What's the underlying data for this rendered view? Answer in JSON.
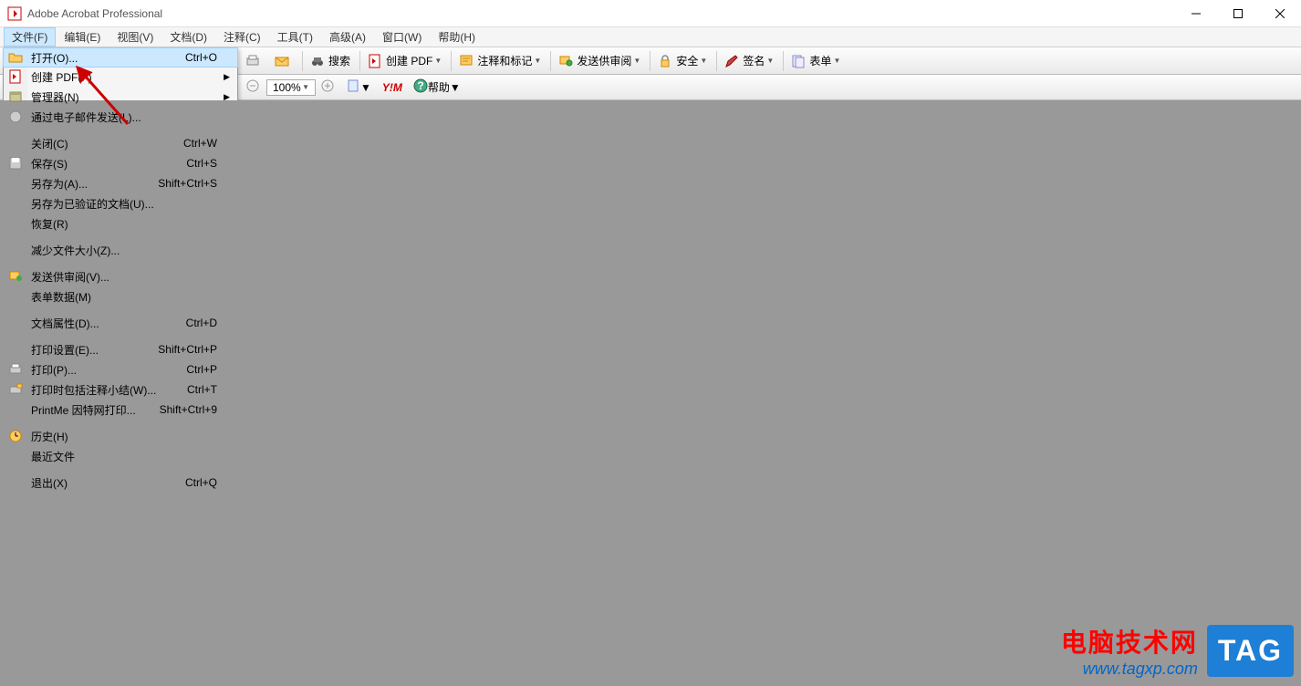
{
  "titlebar": {
    "title": "Adobe Acrobat Professional"
  },
  "menubar": {
    "items": [
      {
        "label": "文件(F)"
      },
      {
        "label": "编辑(E)"
      },
      {
        "label": "视图(V)"
      },
      {
        "label": "文档(D)"
      },
      {
        "label": "注释(C)"
      },
      {
        "label": "工具(T)"
      },
      {
        "label": "高级(A)"
      },
      {
        "label": "窗口(W)"
      },
      {
        "label": "帮助(H)"
      }
    ]
  },
  "toolbar": {
    "search": "搜索",
    "create_pdf": "创建 PDF",
    "comment_mark": "注释和标记",
    "send_review": "发送供审阅",
    "security": "安全",
    "sign": "签名",
    "forms": "表单"
  },
  "toolbar2": {
    "zoom": "100%",
    "help": "帮助"
  },
  "dropdown": {
    "open": {
      "label": "打开(O)...",
      "shortcut": "Ctrl+O"
    },
    "create_pdf": {
      "label": "创建 PDF(F)"
    },
    "organizer": {
      "label": "管理器(N)"
    },
    "email": {
      "label": "通过电子邮件发送(L)..."
    },
    "close": {
      "label": "关闭(C)",
      "shortcut": "Ctrl+W"
    },
    "save": {
      "label": "保存(S)",
      "shortcut": "Ctrl+S"
    },
    "save_as": {
      "label": "另存为(A)...",
      "shortcut": "Shift+Ctrl+S"
    },
    "save_certified": {
      "label": "另存为已验证的文档(U)..."
    },
    "revert": {
      "label": "恢复(R)"
    },
    "reduce_size": {
      "label": "减少文件大小(Z)..."
    },
    "send_for_review": {
      "label": "发送供审阅(V)..."
    },
    "form_data": {
      "label": "表单数据(M)"
    },
    "doc_properties": {
      "label": "文档属性(D)...",
      "shortcut": "Ctrl+D"
    },
    "print_setup": {
      "label": "打印设置(E)...",
      "shortcut": "Shift+Ctrl+P"
    },
    "print": {
      "label": "打印(P)...",
      "shortcut": "Ctrl+P"
    },
    "print_with_comments": {
      "label": "打印时包括注释小结(W)...",
      "shortcut": "Ctrl+T"
    },
    "printme": {
      "label": "PrintMe 因特网打印...",
      "shortcut": "Shift+Ctrl+9"
    },
    "history": {
      "label": "历史(H)"
    },
    "recent": {
      "label": "最近文件"
    },
    "exit": {
      "label": "退出(X)",
      "shortcut": "Ctrl+Q"
    }
  },
  "watermark": {
    "line1": "电脑技术网",
    "line2": "www.tagxp.com",
    "tag": "TAG"
  }
}
